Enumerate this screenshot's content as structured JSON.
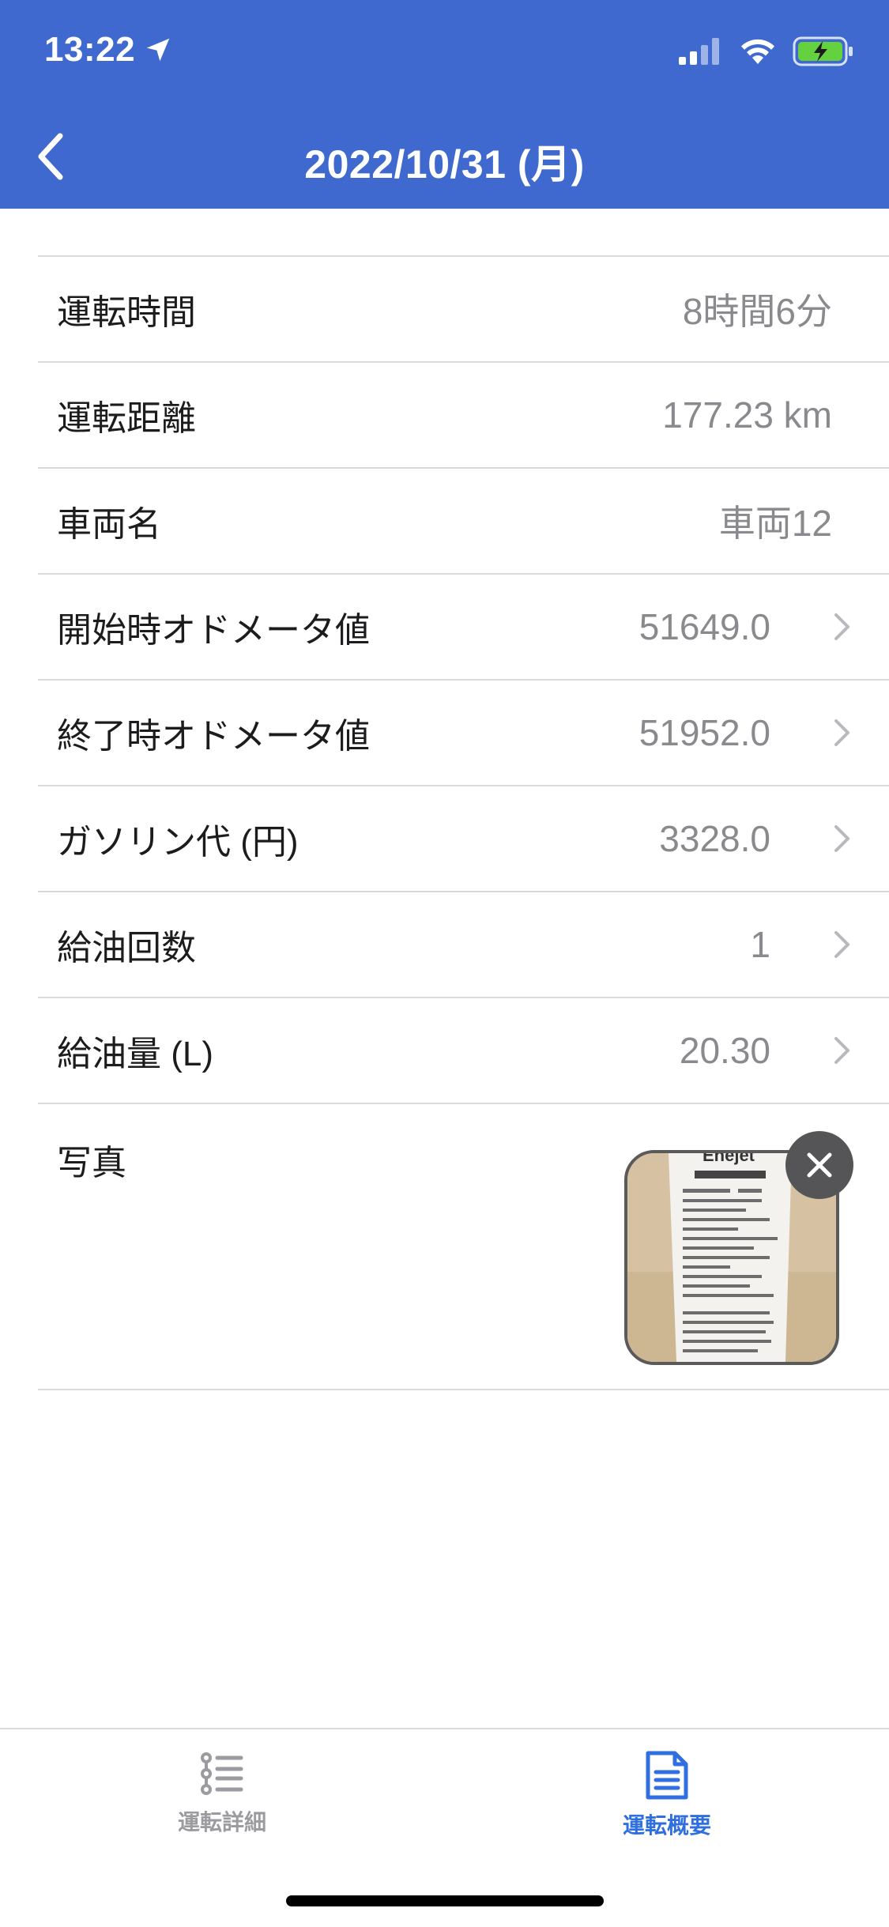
{
  "status_bar": {
    "time": "13:22"
  },
  "nav": {
    "title": "2022/10/31 (月)"
  },
  "rows": [
    {
      "label": "運転時間",
      "value": "8時間6分",
      "chevron": false
    },
    {
      "label": "運転距離",
      "value": "177.23 km",
      "chevron": false
    },
    {
      "label": "車両名",
      "value": "車両12",
      "chevron": false
    },
    {
      "label": "開始時オドメータ値",
      "value": "51649.0",
      "chevron": true
    },
    {
      "label": "終了時オドメータ値",
      "value": "51952.0",
      "chevron": true
    },
    {
      "label": "ガソリン代 (円)",
      "value": "3328.0",
      "chevron": true
    },
    {
      "label": "給油回数",
      "value": "1",
      "chevron": true
    },
    {
      "label": "給油量 (L)",
      "value": "20.30",
      "chevron": true
    }
  ],
  "photo": {
    "label": "写真",
    "thumbnail_text": "Enejet"
  },
  "tabs": [
    {
      "label": "運転詳細",
      "icon": "list-steps-icon",
      "active": false
    },
    {
      "label": "運転概要",
      "icon": "document-icon",
      "active": true
    }
  ],
  "colors": {
    "header": "#3f69cf",
    "active_tab": "#2f6fe0",
    "inactive_tab": "#9b9ba0"
  }
}
